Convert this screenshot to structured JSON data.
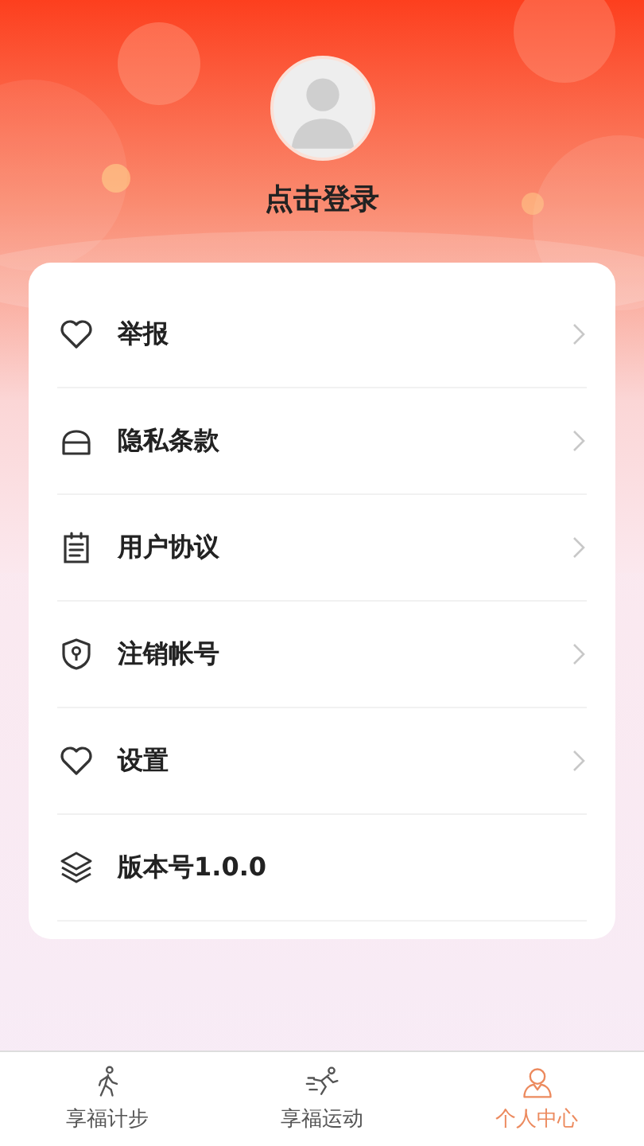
{
  "profile": {
    "login_label": "点击登录"
  },
  "menu": [
    {
      "label": "举报",
      "kind": "link"
    },
    {
      "label": "隐私条款",
      "kind": "link"
    },
    {
      "label": "用户协议",
      "kind": "link"
    },
    {
      "label": "注销帐号",
      "kind": "link"
    },
    {
      "label": "设置",
      "kind": "link"
    },
    {
      "label": "版本号1.0.0",
      "kind": "info"
    }
  ],
  "tabs": [
    {
      "label": "享福计步",
      "selected": false
    },
    {
      "label": "享福运动",
      "selected": false
    },
    {
      "label": "个人中心",
      "selected": true
    }
  ]
}
